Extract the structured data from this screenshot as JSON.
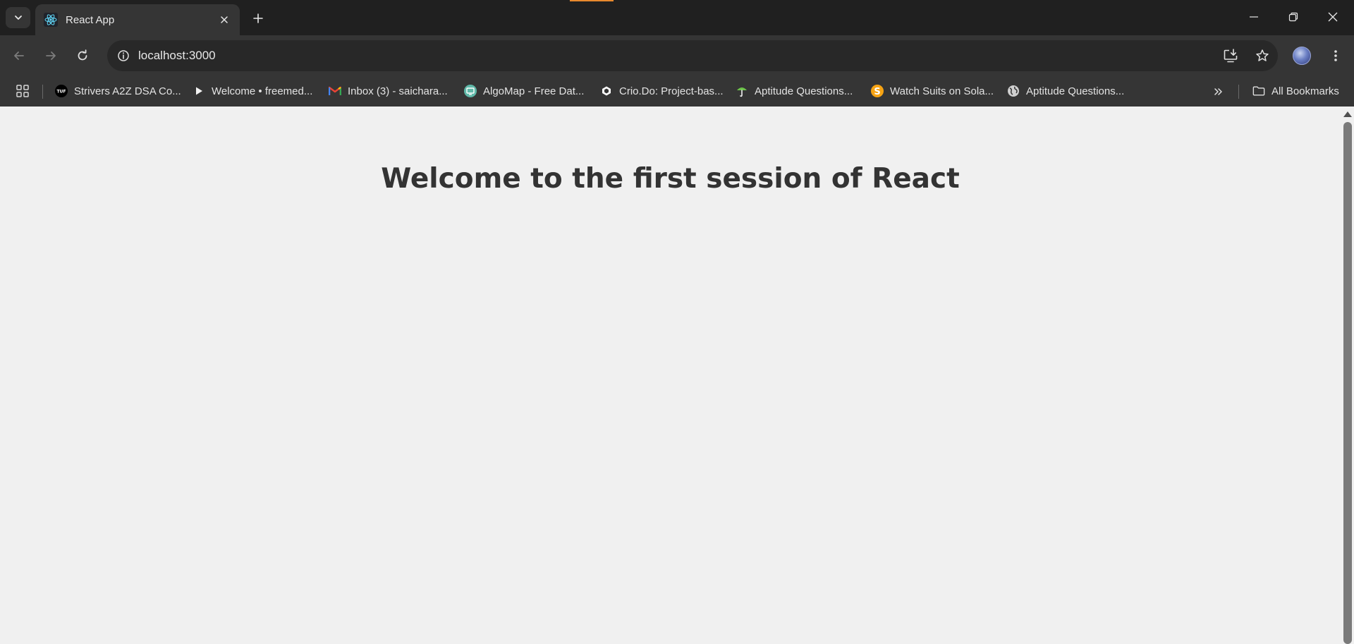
{
  "browser": {
    "tab": {
      "title": "React App",
      "favicon": "react-logo-icon"
    },
    "tab_search_icon": "chevron-down-icon",
    "new_tab_icon": "plus-icon",
    "window_controls": [
      "minimize-icon",
      "restore-icon",
      "close-icon"
    ],
    "media_indicator_color": "#e8892d"
  },
  "toolbar": {
    "back_icon": "arrow-left-icon",
    "forward_icon": "arrow-right-icon",
    "reload_icon": "reload-icon",
    "site_info_icon": "info-icon",
    "url": "localhost:3000",
    "install_icon": "install-app-icon",
    "bookmark_icon": "star-icon",
    "menu_icon": "kebab-menu-icon"
  },
  "bookmarks": {
    "items": [
      {
        "label": "Strivers A2Z DSA Co...",
        "icon": "tuf-logo-icon"
      },
      {
        "label": "Welcome • freemed...",
        "icon": "play-icon"
      },
      {
        "label": "Inbox (3) - saichara...",
        "icon": "gmail-icon"
      },
      {
        "label": "AlgoMap - Free Dat...",
        "icon": "algomap-icon"
      },
      {
        "label": "Crio.Do: Project-bas...",
        "icon": "crio-icon"
      },
      {
        "label": "Aptitude Questions...",
        "icon": "indiabix-icon"
      },
      {
        "label": "Watch Suits on Sola...",
        "icon": "solarmovie-icon"
      },
      {
        "label": "Aptitude Questions...",
        "icon": "globe-icon"
      }
    ],
    "all_bookmarks_label": "All Bookmarks"
  },
  "page": {
    "heading": "Welcome to the first session of React"
  },
  "colors": {
    "chrome_dark": "#202020",
    "toolbar": "#353535",
    "omnibox": "#282828",
    "page_bg": "#f0f0f0",
    "heading": "#333333"
  }
}
